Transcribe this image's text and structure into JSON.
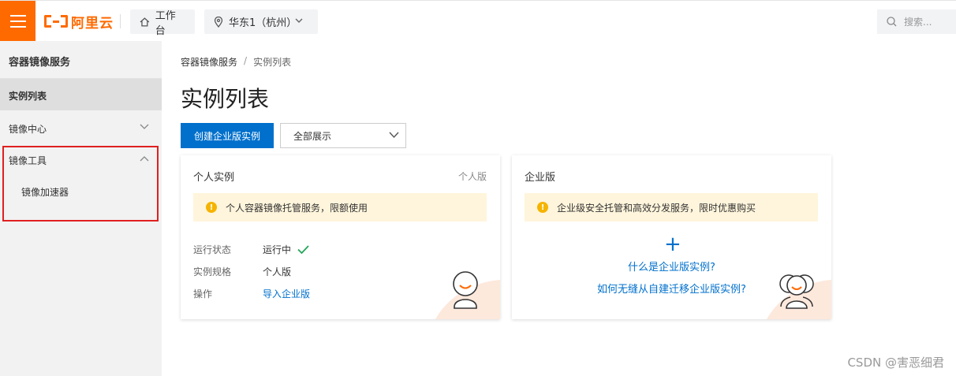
{
  "topbar": {
    "brand": "阿里云",
    "workbench_label": "工作台",
    "region_label": "华东1（杭州）",
    "search_placeholder": "搜索..."
  },
  "sidebar": {
    "title": "容器镜像服务",
    "items": [
      {
        "label": "实例列表",
        "active": true
      },
      {
        "label": "镜像中心",
        "expanded": false
      },
      {
        "label": "镜像工具",
        "expanded": true
      }
    ],
    "sub_items": [
      {
        "label": "镜像加速器"
      }
    ]
  },
  "breadcrumb": {
    "root": "容器镜像服务",
    "separator": "/",
    "current": "实例列表"
  },
  "page_title": "实例列表",
  "toolbar": {
    "create_label": "创建企业版实例",
    "filter_value": "全部展示"
  },
  "cards": {
    "personal": {
      "title": "个人实例",
      "tag": "个人版",
      "notice": "个人容器镜像托管服务，限额使用",
      "rows": [
        {
          "key": "运行状态",
          "value": "运行中"
        },
        {
          "key": "实例规格",
          "value": "个人版"
        },
        {
          "key": "操作",
          "value": "导入企业版"
        }
      ]
    },
    "enterprise": {
      "title": "企业版",
      "notice": "企业级安全托管和高效分发服务，限时优惠购买",
      "plus": "+",
      "link_what": "什么是企业版实例?",
      "link_migrate": "如何无缝从自建迁移企业版实例?"
    }
  },
  "watermark": "CSDN @害恶细君",
  "colors": {
    "accent": "#ff6a00",
    "primary": "#0070cc",
    "notice_bg": "#fff5dc",
    "success": "#23a55a",
    "highlight_box": "#e02020"
  }
}
